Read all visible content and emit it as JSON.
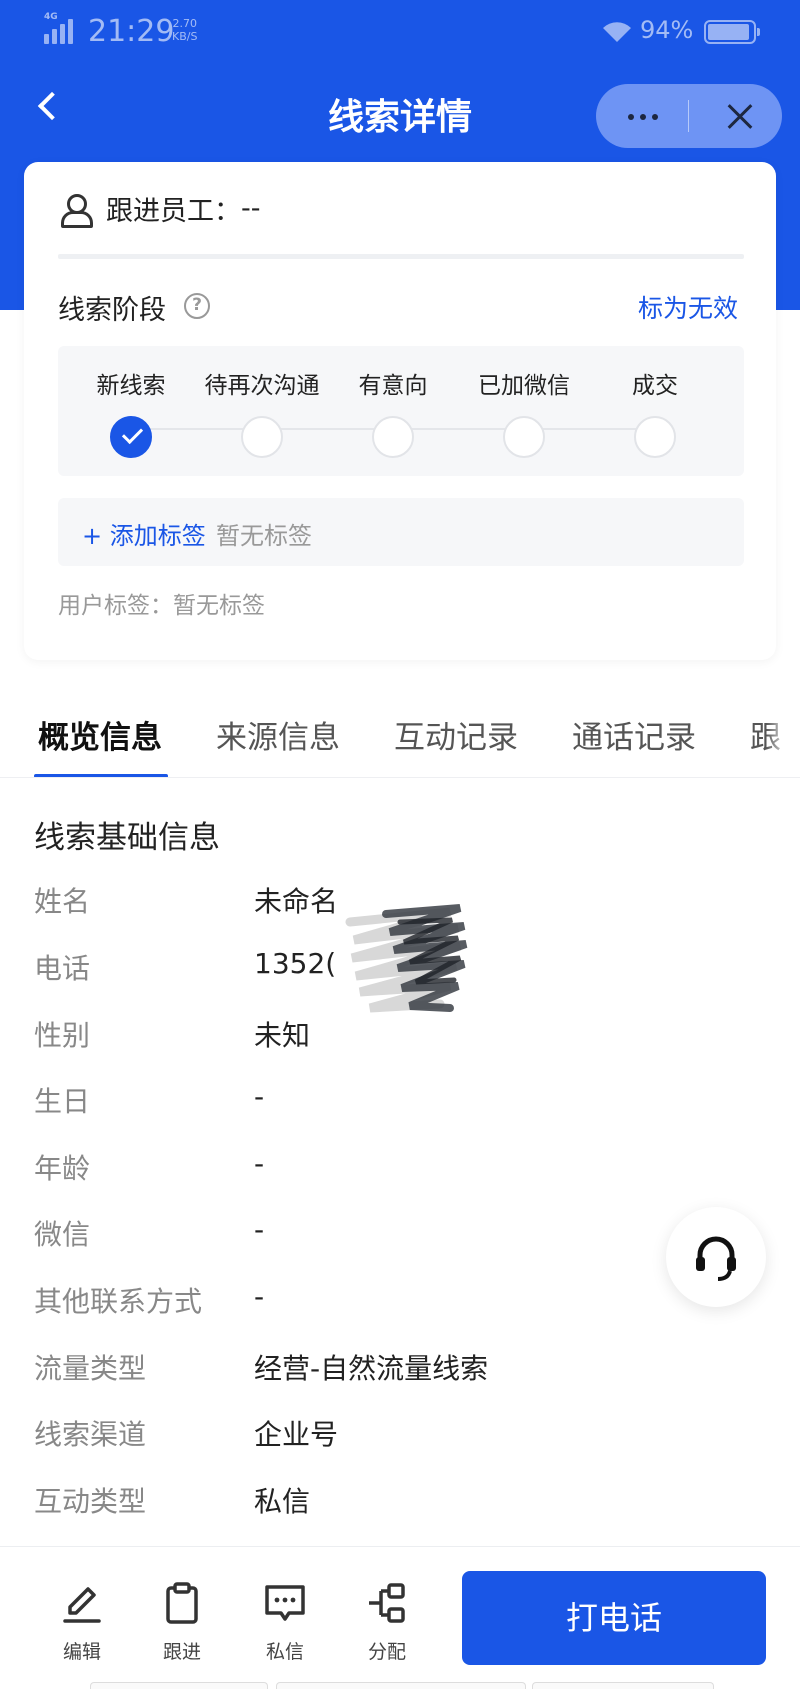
{
  "status_bar": {
    "network": "4G",
    "time": "21:29",
    "speed_value": "2.70",
    "speed_unit": "KB/S",
    "battery_percent": "94%",
    "battery_level": 0.94
  },
  "nav": {
    "title": "线索详情",
    "back_icon": "chevron-left-icon",
    "more_icon": "more-dots-icon",
    "close_icon": "close-icon"
  },
  "card": {
    "staff_label": "跟进员工：",
    "staff_value": "--",
    "stage_title": "线索阶段",
    "help_glyph": "?",
    "mark_invalid": "标为无效",
    "stages": [
      {
        "label": "新线索",
        "done": true
      },
      {
        "label": "待再次沟通",
        "done": false
      },
      {
        "label": "有意向",
        "done": false
      },
      {
        "label": "已加微信",
        "done": false
      },
      {
        "label": "成交",
        "done": false
      }
    ],
    "add_tag": "+ 添加标签",
    "no_tag": "暂无标签",
    "user_tags": "用户标签：暂无标签"
  },
  "tabs": [
    "概览信息",
    "来源信息",
    "互动记录",
    "通话记录",
    "跟"
  ],
  "active_tab": 0,
  "section_title": "线索基础信息",
  "info_rows": [
    {
      "key": "姓名",
      "value": "未命名"
    },
    {
      "key": "电话",
      "value": "1352("
    },
    {
      "key": "性别",
      "value": "未知"
    },
    {
      "key": "生日",
      "value": "-"
    },
    {
      "key": "年龄",
      "value": "-"
    },
    {
      "key": "微信",
      "value": "-"
    },
    {
      "key": "其他联系方式",
      "value": "-"
    },
    {
      "key": "流量类型",
      "value": "经营-自然流量线索"
    },
    {
      "key": "线索渠道",
      "value": "企业号"
    },
    {
      "key": "互动类型",
      "value": "私信"
    }
  ],
  "actions": [
    {
      "label": "编辑",
      "icon": "pencil-icon"
    },
    {
      "label": "跟进",
      "icon": "clipboard-icon"
    },
    {
      "label": "私信",
      "icon": "message-icon"
    },
    {
      "label": "分配",
      "icon": "assign-icon"
    }
  ],
  "call_button": "打电话",
  "colors": {
    "primary": "#1a56e6",
    "muted_text": "#888888"
  }
}
